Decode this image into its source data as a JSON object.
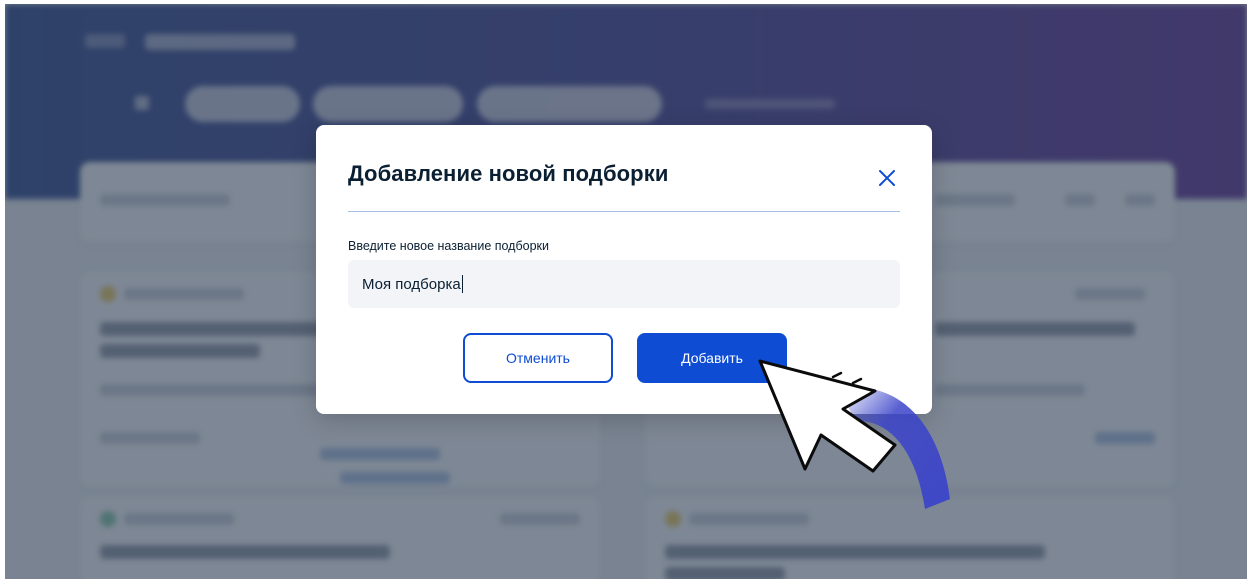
{
  "dialog": {
    "title": "Добавление новой подборки",
    "field_label": "Введите новое название подборки",
    "input_value": "Моя подборка",
    "cancel_label": "Отменить",
    "add_label": "Добавить",
    "close_icon": "close-icon"
  },
  "colors": {
    "primary": "#0d4cd3",
    "title_text": "#0b1f33",
    "divider": "#a9c0e2",
    "input_bg": "#f2f4f7",
    "scrim": "#344256",
    "header_gradient_start": "#27428a",
    "header_gradient_end": "#5a2a8e"
  },
  "pointer": {
    "icon": "hand-cursor-icon"
  }
}
